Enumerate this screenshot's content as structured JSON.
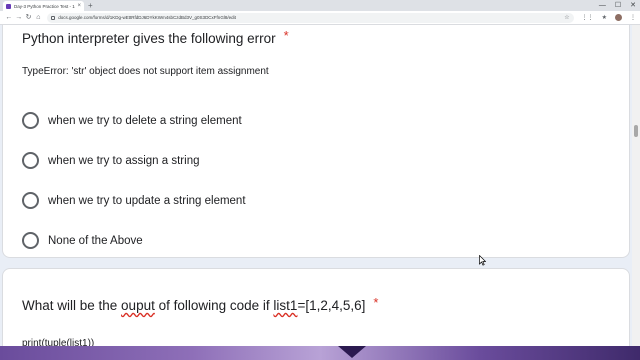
{
  "browser": {
    "tab_title": "Day-3 Python Practice Test - 10...",
    "tab_close": "×",
    "new_tab": "+",
    "url": "docs.google.com/forms/d/1KDg-wEttRfdDJ6DYkKWm4sbCzdBd3V_g0S3DCxFfnGl8/edit",
    "nav": {
      "back": "←",
      "forward": "→",
      "reload": "↻",
      "home": "⌂"
    },
    "bookmark": "☆",
    "extensions": [
      "⋮⋮",
      "★",
      "⋮"
    ],
    "window_controls": {
      "minimize": "—",
      "maximize": "☐",
      "close": "✕"
    }
  },
  "question1": {
    "title": "Python interpreter gives the following error",
    "required_mark": "*",
    "description": "TypeError: 'str' object does not support item assignment",
    "options": [
      "when we try to delete a string element",
      "when we try to assign a string",
      "when we try to update a string element",
      "None of the Above"
    ]
  },
  "question2": {
    "title_prefix": "What will be the ",
    "title_misspelled": "ouput",
    "title_mid": " of following code if ",
    "title_var": "list1",
    "title_suffix": "=[1,2,4,5,6]",
    "required_mark": "*",
    "code": "print(tuple(list1))"
  },
  "colors": {
    "required": "#d93025",
    "text": "#202124",
    "radio_border": "#5f6368",
    "page_bg": "#e9eef6"
  }
}
